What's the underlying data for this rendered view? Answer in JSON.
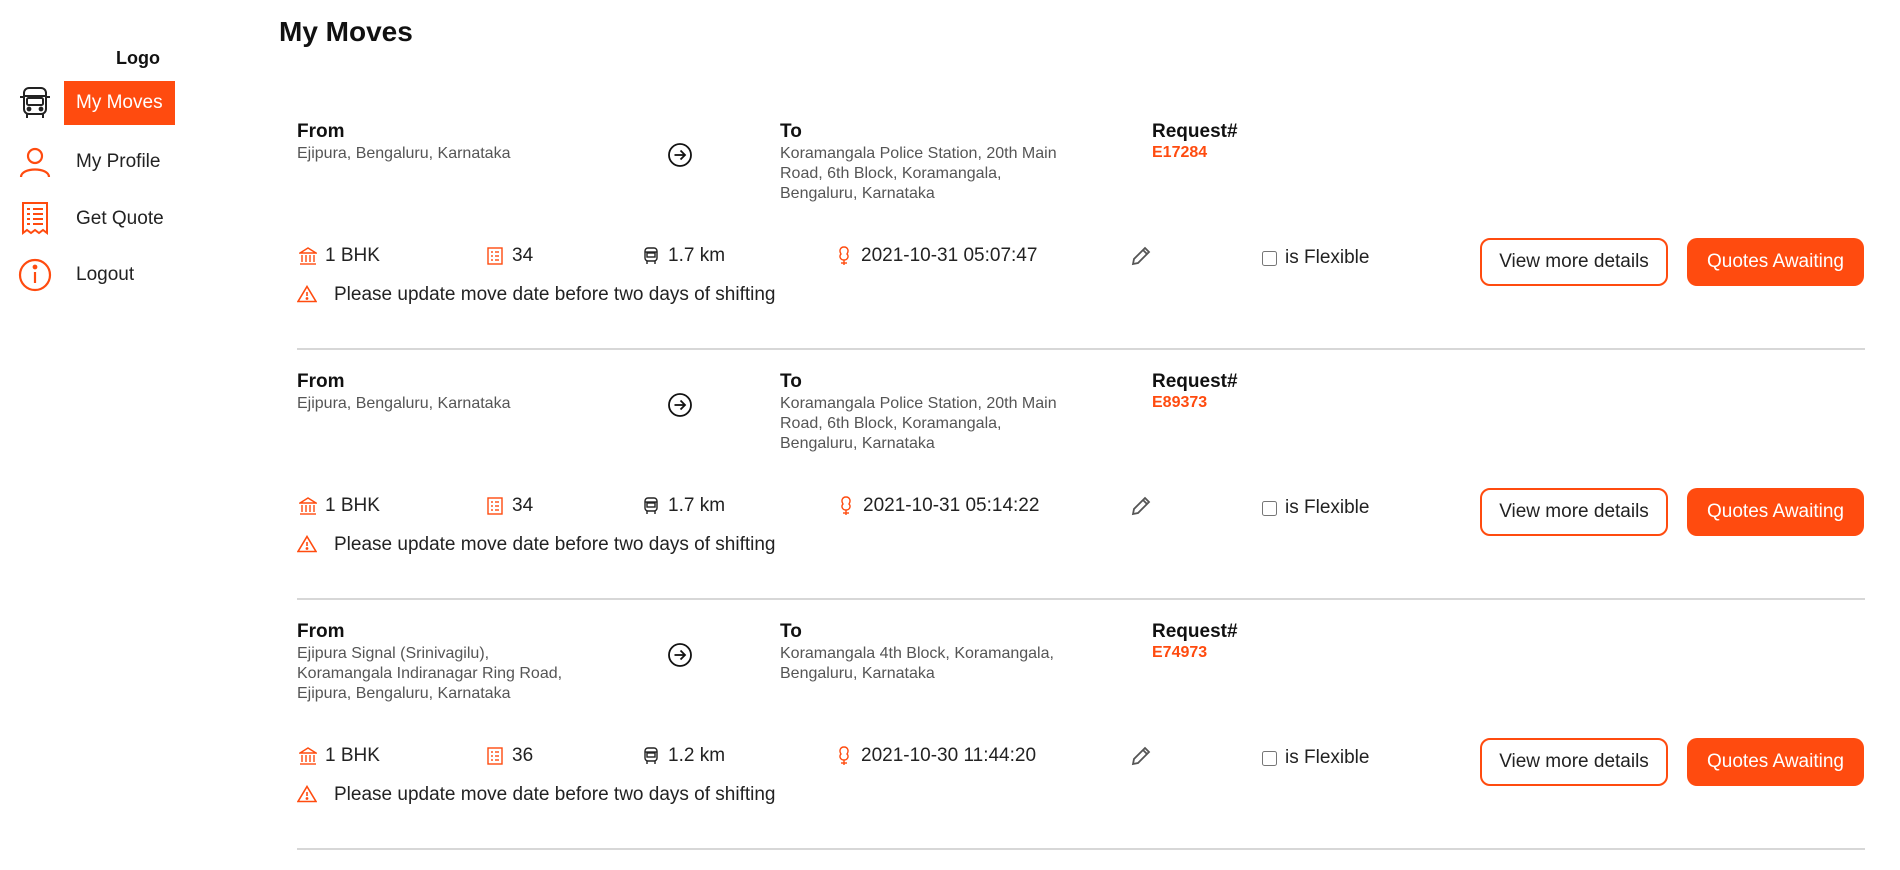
{
  "sidebar": {
    "logo": "Logo",
    "items": [
      {
        "label": "My Moves",
        "icon": "truck-icon",
        "active": true
      },
      {
        "label": "My Profile",
        "icon": "user-icon",
        "active": false
      },
      {
        "label": "Get Quote",
        "icon": "receipt-icon",
        "active": false
      },
      {
        "label": "Logout",
        "icon": "info-icon",
        "active": false
      }
    ]
  },
  "page": {
    "title": "My Moves"
  },
  "labels": {
    "from": "From",
    "to": "To",
    "request": "Request#",
    "flexible": "is Flexible",
    "view_details": "View more details",
    "quotes": "Quotes Awaiting",
    "warning": "Please update move date before two days of shifting"
  },
  "moves": [
    {
      "from": "Ejipura, Bengaluru, Karnataka",
      "to": "Koramangala Police Station, 20th Main Road, 6th Block, Koramangala, Bengaluru, Karnataka",
      "request_id": "E17284",
      "house_type": "1 BHK",
      "items": "34",
      "distance": "1.7 km",
      "datetime": "2021-10-31 05:07:47",
      "is_flexible": false
    },
    {
      "from": "Ejipura, Bengaluru, Karnataka",
      "to": "Koramangala Police Station, 20th Main Road, 6th Block, Koramangala, Bengaluru, Karnataka",
      "request_id": "E89373",
      "house_type": "1 BHK",
      "items": "34",
      "distance": "1.7 km",
      "datetime": "2021-10-31 05:14:22",
      "is_flexible": false
    },
    {
      "from": "Ejipura Signal (Srinivagilu), Koramangala Indiranagar Ring Road, Ejipura, Bengaluru, Karnataka",
      "to": "Koramangala 4th Block, Koramangala, Bengaluru, Karnataka",
      "request_id": "E74973",
      "house_type": "1 BHK",
      "items": "36",
      "distance": "1.2 km",
      "datetime": "2021-10-30 11:44:20",
      "is_flexible": false
    }
  ],
  "colors": {
    "accent": "#ff4b0f",
    "divider": "#d7d7d7"
  }
}
